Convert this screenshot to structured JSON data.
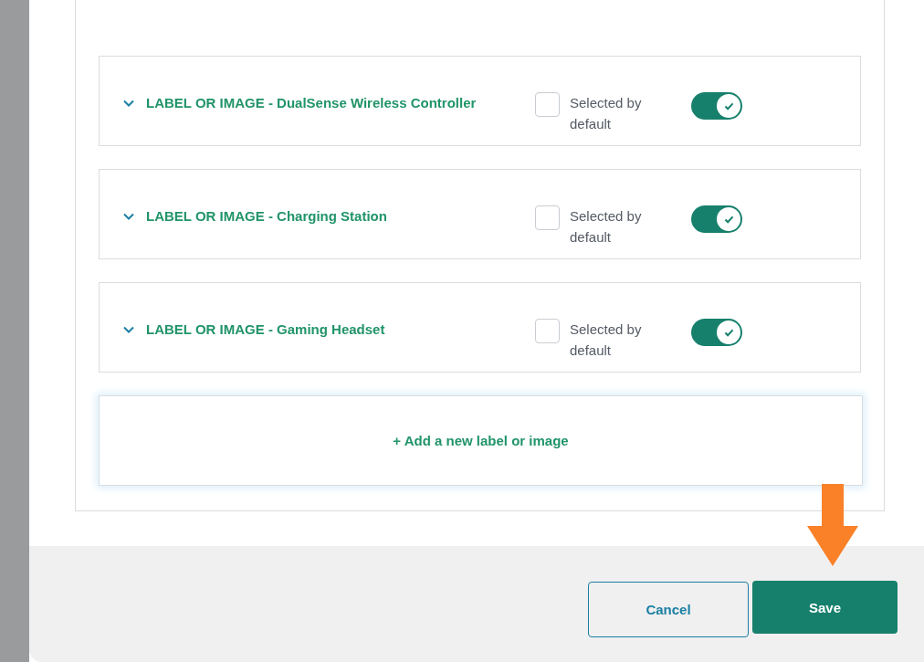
{
  "items": [
    {
      "title": "LABEL OR IMAGE - DualSense Wireless Controller",
      "default_label": "Selected by default",
      "checked": false,
      "on": true
    },
    {
      "title": "LABEL OR IMAGE - Charging Station",
      "default_label": "Selected by default",
      "checked": false,
      "on": true
    },
    {
      "title": "LABEL OR IMAGE - Gaming Headset",
      "default_label": "Selected by default",
      "checked": false,
      "on": true
    }
  ],
  "add_button": "+ Add a new label or image",
  "buttons": [
    {
      "label": "Cancel",
      "kind": "secondary"
    },
    {
      "label": "Save",
      "kind": "primary"
    }
  ]
}
